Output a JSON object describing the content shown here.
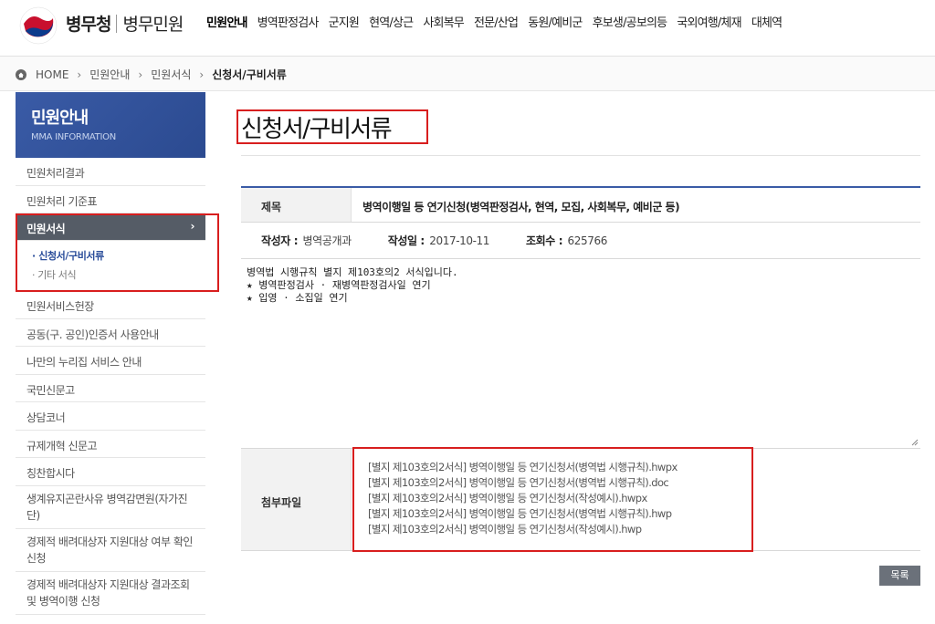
{
  "header": {
    "brand": "병무청",
    "brand_sub": "병무민원",
    "nav": [
      "민원안내",
      "병역판정검사",
      "군지원",
      "현역/상근",
      "사회복무",
      "전문/산업",
      "동원/예비군",
      "후보생/공보의등",
      "국외여행/체재",
      "대체역"
    ]
  },
  "breadcrumb": [
    "HOME",
    "민원안내",
    "민원서식",
    "신청서/구비서류"
  ],
  "sidebar": {
    "title": "민원안내",
    "subtitle": "MMA INFORMATION",
    "items_top": [
      "민원처리결과",
      "민원처리 기준표"
    ],
    "active": "민원서식",
    "sub_items": [
      "신청서/구비서류",
      "기타 서식"
    ],
    "items_bottom": [
      "민원서비스헌장",
      "공동(구. 공인)인증서 사용안내",
      "나만의 누리집 서비스 안내",
      "국민신문고",
      "상담코너",
      "규제개혁 신문고",
      "칭찬합시다"
    ],
    "items_two_line": [
      "생계유지곤란사유 병역감면원(자가진단)",
      "경제적 배려대상자 지원대상 여부 확인 신청",
      "경제적 배려대상자 지원대상 결과조회 및 병역이행 신청"
    ]
  },
  "page_title": "신청서/구비서류",
  "post": {
    "label_title": "제목",
    "title": "병역이행일 등 연기신청(병역판정검사, 현역, 모집, 사회복무, 예비군 등)",
    "label_author": "작성자 :",
    "author": "병역공개과",
    "label_date": "작성일 :",
    "date": "2017-10-11",
    "label_views": "조회수 :",
    "views": "625766",
    "content_lines": [
      "병역법 시행규칙 별지 제103호의2 서식입니다.",
      "",
      "★ 병역판정검사 · 재병역판정검사일 연기",
      "★ 입영 · 소집일 연기"
    ],
    "label_files": "첨부파일",
    "files": [
      "[별지 제103호의2서식] 병역이행일 등 연기신청서(병역법 시행규칙).hwpx",
      "[별지 제103호의2서식] 병역이행일 등 연기신청서(병역법 시행규칙).doc",
      "[별지 제103호의2서식] 병역이행일 등 연기신청서(작성예시).hwpx",
      "[별지 제103호의2서식] 병역이행일 등 연기신청서(병역법 시행규칙).hwp",
      "[별지 제103호의2서식] 병역이행일 등 연기신청서(작성예시).hwp"
    ]
  },
  "list_button": "목록",
  "colors": {
    "accent": "#3a5ba6",
    "highlight": "#d81e1e"
  }
}
